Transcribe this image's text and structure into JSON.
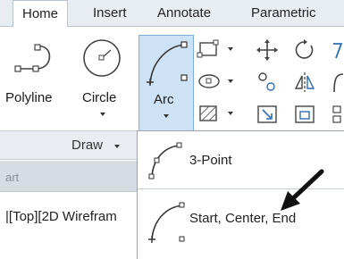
{
  "tabs": [
    "Home",
    "Insert",
    "Annotate",
    "Parametric"
  ],
  "ribbon": {
    "polyline_label": "Polyline",
    "circle_label": "Circle",
    "arc_label": "Arc"
  },
  "panel": {
    "draw_label": "Draw"
  },
  "left": {
    "gray_row_text": "art",
    "viewport_label": "|[Top][2D Wirefram"
  },
  "arc_menu": {
    "items": [
      "3-Point",
      "Start, Center, End"
    ]
  },
  "colors": {
    "accent": "#cde3f5",
    "accent_border": "#7fb0dc",
    "tabbar": "#e8edf2"
  }
}
